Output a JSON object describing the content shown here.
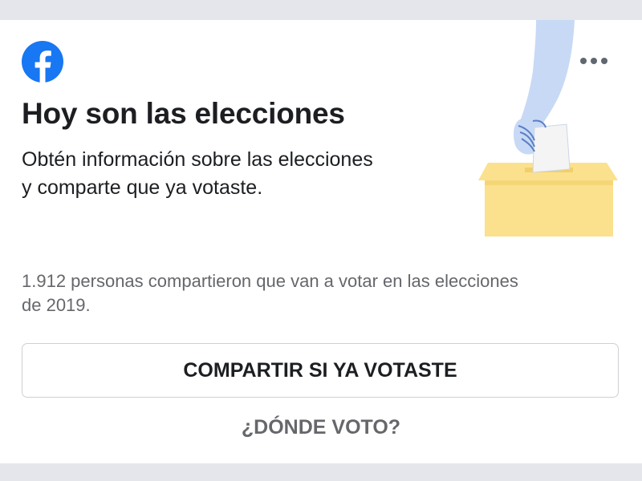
{
  "card": {
    "logo_icon": "facebook-logo-icon",
    "more_icon": "more-options-icon",
    "illustration_icon": "voting-ballot-box-illustration",
    "title": "Hoy son las elecciones",
    "subtitle": "Obtén información sobre las elecciones y comparte que ya votaste.",
    "stats": "1.912 personas compartieron que van a votar en las elecciones de 2019.",
    "share_button_label": "COMPARTIR SI YA VOTASTE",
    "where_link_label": "¿DÓNDE VOTO?"
  },
  "colors": {
    "brand_blue": "#1877f2",
    "ballot_box_yellow": "#fbe18d",
    "arm_blue": "#c7d9f5",
    "primary_text": "#1c1e21",
    "secondary_text": "#65676b",
    "page_background": "#e4e6eb"
  }
}
